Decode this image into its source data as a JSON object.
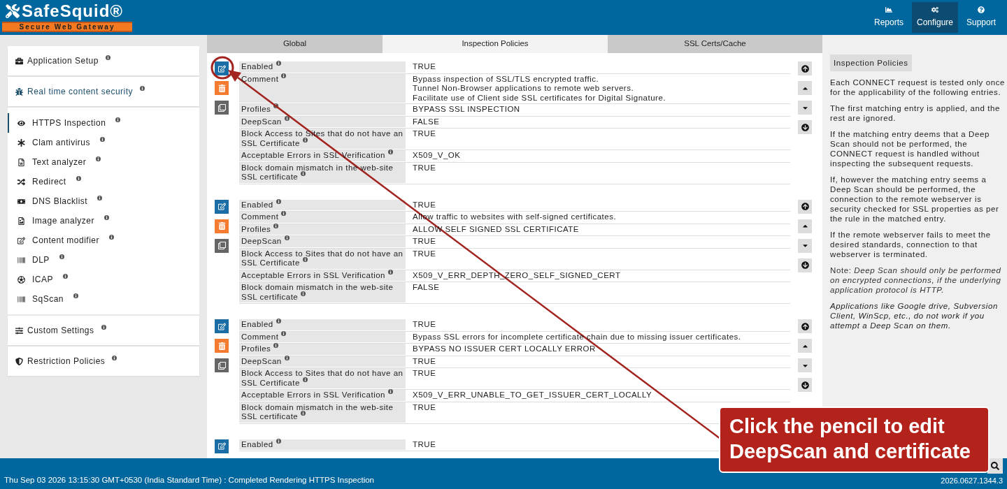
{
  "header": {
    "logo": {
      "name": "SafeSquid®",
      "tagline": "Secure Web Gateway"
    },
    "nav": [
      {
        "label": "Reports",
        "selected": false
      },
      {
        "label": "Configure",
        "selected": true
      },
      {
        "label": "Support",
        "selected": false
      }
    ]
  },
  "sidebar": {
    "sections": [
      {
        "label": "Application Setup",
        "expanded": false
      },
      {
        "label": "Real time content security",
        "expanded": true,
        "children": [
          {
            "label": "HTTPS Inspection",
            "selected": true
          },
          {
            "label": "Clam antivirus",
            "selected": false
          },
          {
            "label": "Text analyzer",
            "selected": false
          },
          {
            "label": "Redirect",
            "selected": false
          },
          {
            "label": "DNS Blacklist",
            "selected": false
          },
          {
            "label": "Image analyzer",
            "selected": false
          },
          {
            "label": "Content modifier",
            "selected": false
          },
          {
            "label": "DLP",
            "selected": false
          },
          {
            "label": "ICAP",
            "selected": false
          },
          {
            "label": "SqScan",
            "selected": false
          }
        ]
      },
      {
        "label": "Custom Settings",
        "expanded": false
      },
      {
        "label": "Restriction Policies",
        "expanded": false
      }
    ]
  },
  "tabs": [
    {
      "label": "Global",
      "selected": false
    },
    {
      "label": "Inspection Policies",
      "selected": true
    },
    {
      "label": "SSL Certs/Cache",
      "selected": false
    }
  ],
  "policies": [
    {
      "actions": [
        {
          "kind": "edit"
        },
        {
          "kind": "delete"
        },
        {
          "kind": "copy"
        }
      ],
      "moves": [
        {
          "kind": "top"
        },
        {
          "kind": "up"
        },
        {
          "kind": "down"
        },
        {
          "kind": "bottom"
        }
      ],
      "fields": [
        {
          "label": "Enabled",
          "value": "TRUE"
        },
        {
          "label": "Comment",
          "value": "Bypass inspection of SSL/TLS encrypted traffic.\nTunnel Non-Browser applications to remote web servers.\nFacilitate use of Client side SSL certificates for Digital Signature."
        },
        {
          "label": "Profiles",
          "value": "BYPASS SSL INSPECTION"
        },
        {
          "label": "DeepScan",
          "value": "FALSE"
        },
        {
          "label": "Block Access to Sites that do not have an SSL Certificate",
          "value": "TRUE"
        },
        {
          "label": "Acceptable Errors in SSL Verification",
          "value": "X509_V_OK"
        },
        {
          "label": "Block domain mismatch in the web-site SSL certificate",
          "value": "TRUE"
        }
      ]
    },
    {
      "actions": [
        {
          "kind": "edit"
        },
        {
          "kind": "delete"
        },
        {
          "kind": "copy"
        }
      ],
      "moves": [
        {
          "kind": "top"
        },
        {
          "kind": "up"
        },
        {
          "kind": "down"
        },
        {
          "kind": "bottom"
        }
      ],
      "fields": [
        {
          "label": "Enabled",
          "value": "TRUE"
        },
        {
          "label": "Comment",
          "value": "Allow traffic to websites with self-signed certificates."
        },
        {
          "label": "Profiles",
          "value": "ALLOW SELF SIGNED SSL CERTIFICATE"
        },
        {
          "label": "DeepScan",
          "value": "TRUE"
        },
        {
          "label": "Block Access to Sites that do not have an SSL Certificate",
          "value": "TRUE"
        },
        {
          "label": "Acceptable Errors in SSL Verification",
          "value": "X509_V_ERR_DEPTH_ZERO_SELF_SIGNED_CERT"
        },
        {
          "label": "Block domain mismatch in the web-site SSL certificate",
          "value": "FALSE"
        }
      ]
    },
    {
      "actions": [
        {
          "kind": "edit"
        },
        {
          "kind": "delete"
        },
        {
          "kind": "copy"
        }
      ],
      "moves": [
        {
          "kind": "top"
        },
        {
          "kind": "up"
        },
        {
          "kind": "down"
        },
        {
          "kind": "bottom"
        }
      ],
      "fields": [
        {
          "label": "Enabled",
          "value": "TRUE"
        },
        {
          "label": "Comment",
          "value": "Bypass SSL errors for incomplete certificate chain due to missing issuer certificates."
        },
        {
          "label": "Profiles",
          "value": "BYPASS NO ISSUER CERT LOCALLY ERROR"
        },
        {
          "label": "DeepScan",
          "value": "TRUE"
        },
        {
          "label": "Block Access to Sites that do not have an SSL Certificate",
          "value": "TRUE"
        },
        {
          "label": "Acceptable Errors in SSL Verification",
          "value": "X509_V_ERR_UNABLE_TO_GET_ISSUER_CERT_LOCALLY"
        },
        {
          "label": "Block domain mismatch in the web-site SSL certificate",
          "value": "TRUE"
        }
      ]
    },
    {
      "actions": [
        {
          "kind": "edit"
        }
      ],
      "fields": [
        {
          "label": "Enabled",
          "value": "TRUE"
        }
      ]
    }
  ],
  "help": {
    "title": "Inspection Policies",
    "paragraphs": [
      {
        "kind": "text",
        "text": "Each CONNECT request is tested only once for the applicability of the following entries."
      },
      {
        "kind": "text",
        "text": "The first matching entry is applied, and the rest are ignored."
      },
      {
        "kind": "text",
        "text": "If the matching entry deems that a Deep Scan should not be performed, the CONNECT request is handled without inspecting the subsequent requests."
      },
      {
        "kind": "text",
        "text": "If, however the matching entry seems a Deep Scan should be performed, the connection to the remote webserver is security checked for SSL properties as per the rule in the matched entry."
      },
      {
        "kind": "text",
        "text": "If the remote webserver fails to meet the desired standards, connection to that webserver is terminated."
      },
      {
        "kind": "note",
        "text": "Note: *Deep Scan should only be performed on encrypted connections, if the underlying application protocol is HTTP.*"
      },
      {
        "kind": "italic",
        "text": "Applications like Google drive, Subversion Client, WinScp, etc., do not work if you attempt a Deep Scan on them."
      }
    ]
  },
  "status_bar": {
    "message": "Thu Sep 03 2026 13:15:30 GMT+0530 (India Standard Time) : Completed Rendering HTTPS Inspection",
    "version": "2026.0627.1344.3"
  },
  "callout": {
    "text": "Click the pencil to edit DeepScan and certificate"
  }
}
